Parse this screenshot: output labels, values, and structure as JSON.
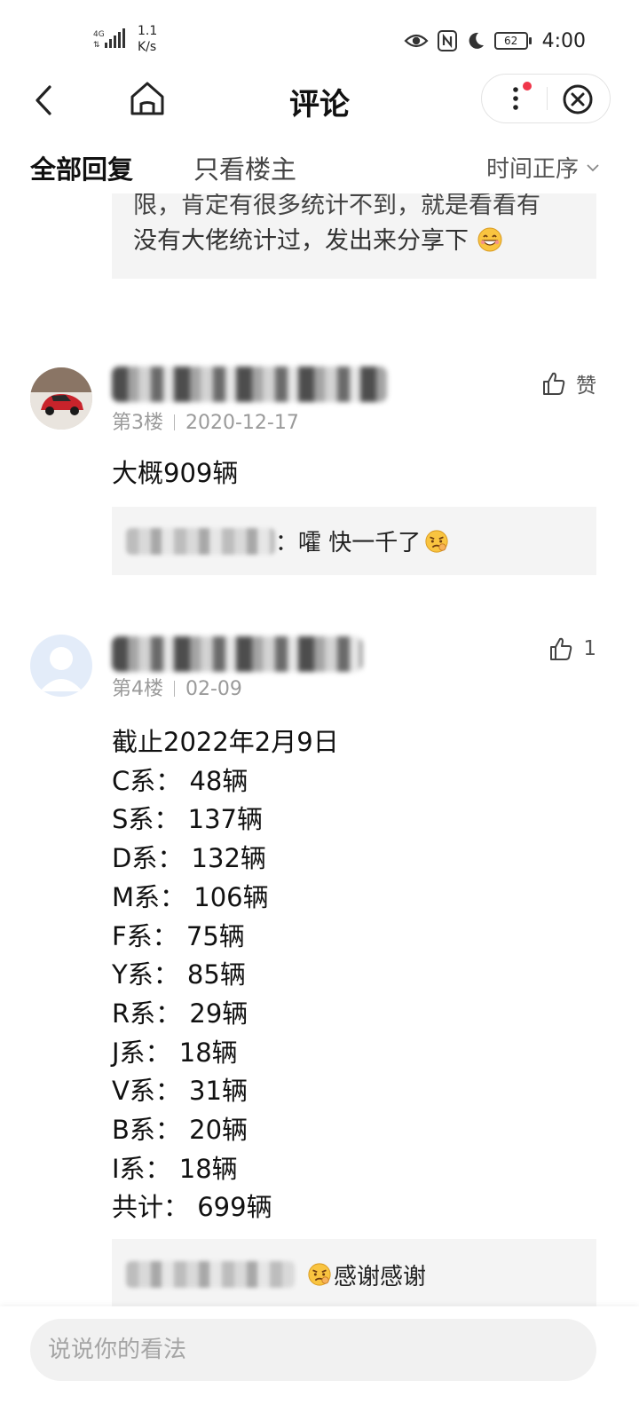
{
  "status_bar": {
    "network": "4G",
    "speed_value": "1.1",
    "speed_unit": "K/s",
    "battery": "62",
    "time": "4:00"
  },
  "header": {
    "title": "评论"
  },
  "tabs": {
    "all_replies": "全部回复",
    "host_only": "只看楼主",
    "sort": "时间正序"
  },
  "quoted_fragment": {
    "line1": "限，肯定有很多统计不到，就是看看有",
    "line2": "没有大佬统计过，发出来分享下"
  },
  "posts": [
    {
      "floor": "第3楼",
      "date": "2020-12-17",
      "like_label": "赞",
      "content": "大概909辆",
      "reply": {
        "text": "：嚯 快一千了"
      }
    },
    {
      "floor": "第4楼",
      "date": "02-09",
      "like_label": "1",
      "content_lines": [
        "截止2022年2月9日",
        "C系： 48辆",
        "S系： 137辆",
        "D系： 132辆",
        "M系： 106辆",
        "F系： 75辆",
        "Y系： 85辆",
        "R系： 29辆",
        "J系： 18辆",
        "V系： 31辆",
        "B系： 20辆",
        "I系： 18辆",
        "共计： 699辆"
      ],
      "reply": {
        "text": "感谢感谢"
      }
    }
  ],
  "input": {
    "placeholder": "说说你的看法"
  },
  "colors": {
    "notification_dot": "#f0364a",
    "box_bg": "#f4f4f4",
    "meta_gray": "#9a9a9a"
  }
}
